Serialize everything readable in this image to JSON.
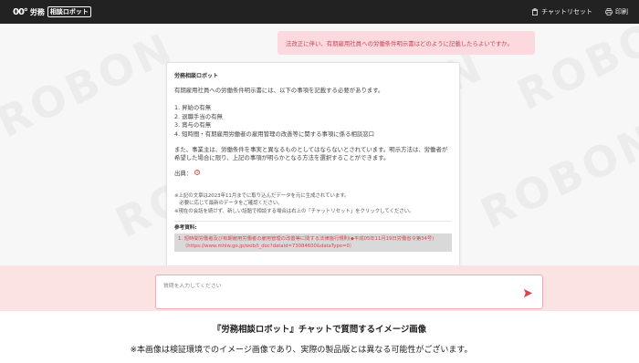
{
  "header": {
    "logo_mark": "00°",
    "logo_text": "労務",
    "logo_box": "相談ロボット",
    "reset_label": "チャットリセット",
    "print_label": "印刷"
  },
  "background": {
    "watermark": "ROBON"
  },
  "chat": {
    "user_message": "法改正に伴い、有期雇用社員への労働条件明示書はどのように記載したらよいですか。",
    "bot": {
      "name": "労務相談ロボット",
      "intro": "有期雇用社員への労働条件明示書には、以下の事項を記載する必要があります。",
      "items": [
        "1. 昇給の有無",
        "2. 退職手当の有無",
        "3. 賞与の有無",
        "4. 短時間・有期雇用労働者の雇用管理の改善等に関する事項に係る相談窓口"
      ],
      "body": "また、事業主は、労働条件を事実と異なるものとしてはならないとされています。明示方法は、労働者が希望した場合に限り、上記の事項が明らかとなる方法を選択することができます。",
      "ref_label": "出典：",
      "ref_marker": "①",
      "notes": [
        "※上記の文章は2023年11月までに取り込んだデータを元に生成されています。",
        "　必要に応じて最新のデータをご確認ください。",
        "※現在の会話を続けず、新しい話題で相談する場合は右上の「チャットリセット」をクリックしてください。"
      ],
      "references_label": "参考資料:",
      "reference_title": "1. 短時間労働者及び有期雇用労働者の雇用管理の改善等に関する法律施行規則(◆平成05年11月19日労働省令第34号)",
      "reference_url": "（https://www.mhlw.go.jp/web/t_doc?dataId=73084600&dataType=0）"
    }
  },
  "input": {
    "placeholder": "質問を入力してください"
  },
  "caption": "『労務相談ロボット』チャットで質問するイメージ画像",
  "notice": "※本画像は検証環境でのイメージ画像であり、実際の製品版とは異なる可能性がございます。",
  "colors": {
    "header_bg": "#222222",
    "user_bubble_bg": "#fbd9de",
    "accent_red": "#d64553",
    "input_area_bg": "#fbe2e3"
  }
}
